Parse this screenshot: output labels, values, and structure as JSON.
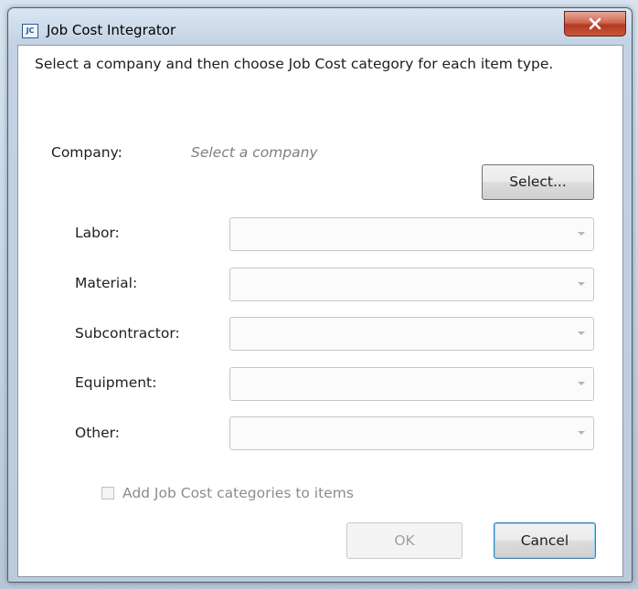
{
  "window": {
    "title": "Job Cost Integrator",
    "app_icon_text": "JC"
  },
  "dialog": {
    "instructions": "Select a company and then choose Job Cost category for each item type.",
    "company_label": "Company:",
    "company_value": "Select a company",
    "select_button": "Select...",
    "fields": [
      {
        "label": "Labor:",
        "value": ""
      },
      {
        "label": "Material:",
        "value": ""
      },
      {
        "label": "Subcontractor:",
        "value": ""
      },
      {
        "label": "Equipment:",
        "value": ""
      },
      {
        "label": "Other:",
        "value": ""
      }
    ],
    "checkbox_label": "Add Job Cost categories to items",
    "checkbox_checked": false,
    "ok_button": "OK",
    "cancel_button": "Cancel"
  },
  "colors": {
    "close_button": "#c9553a",
    "default_button_border": "#3c7fb1"
  }
}
